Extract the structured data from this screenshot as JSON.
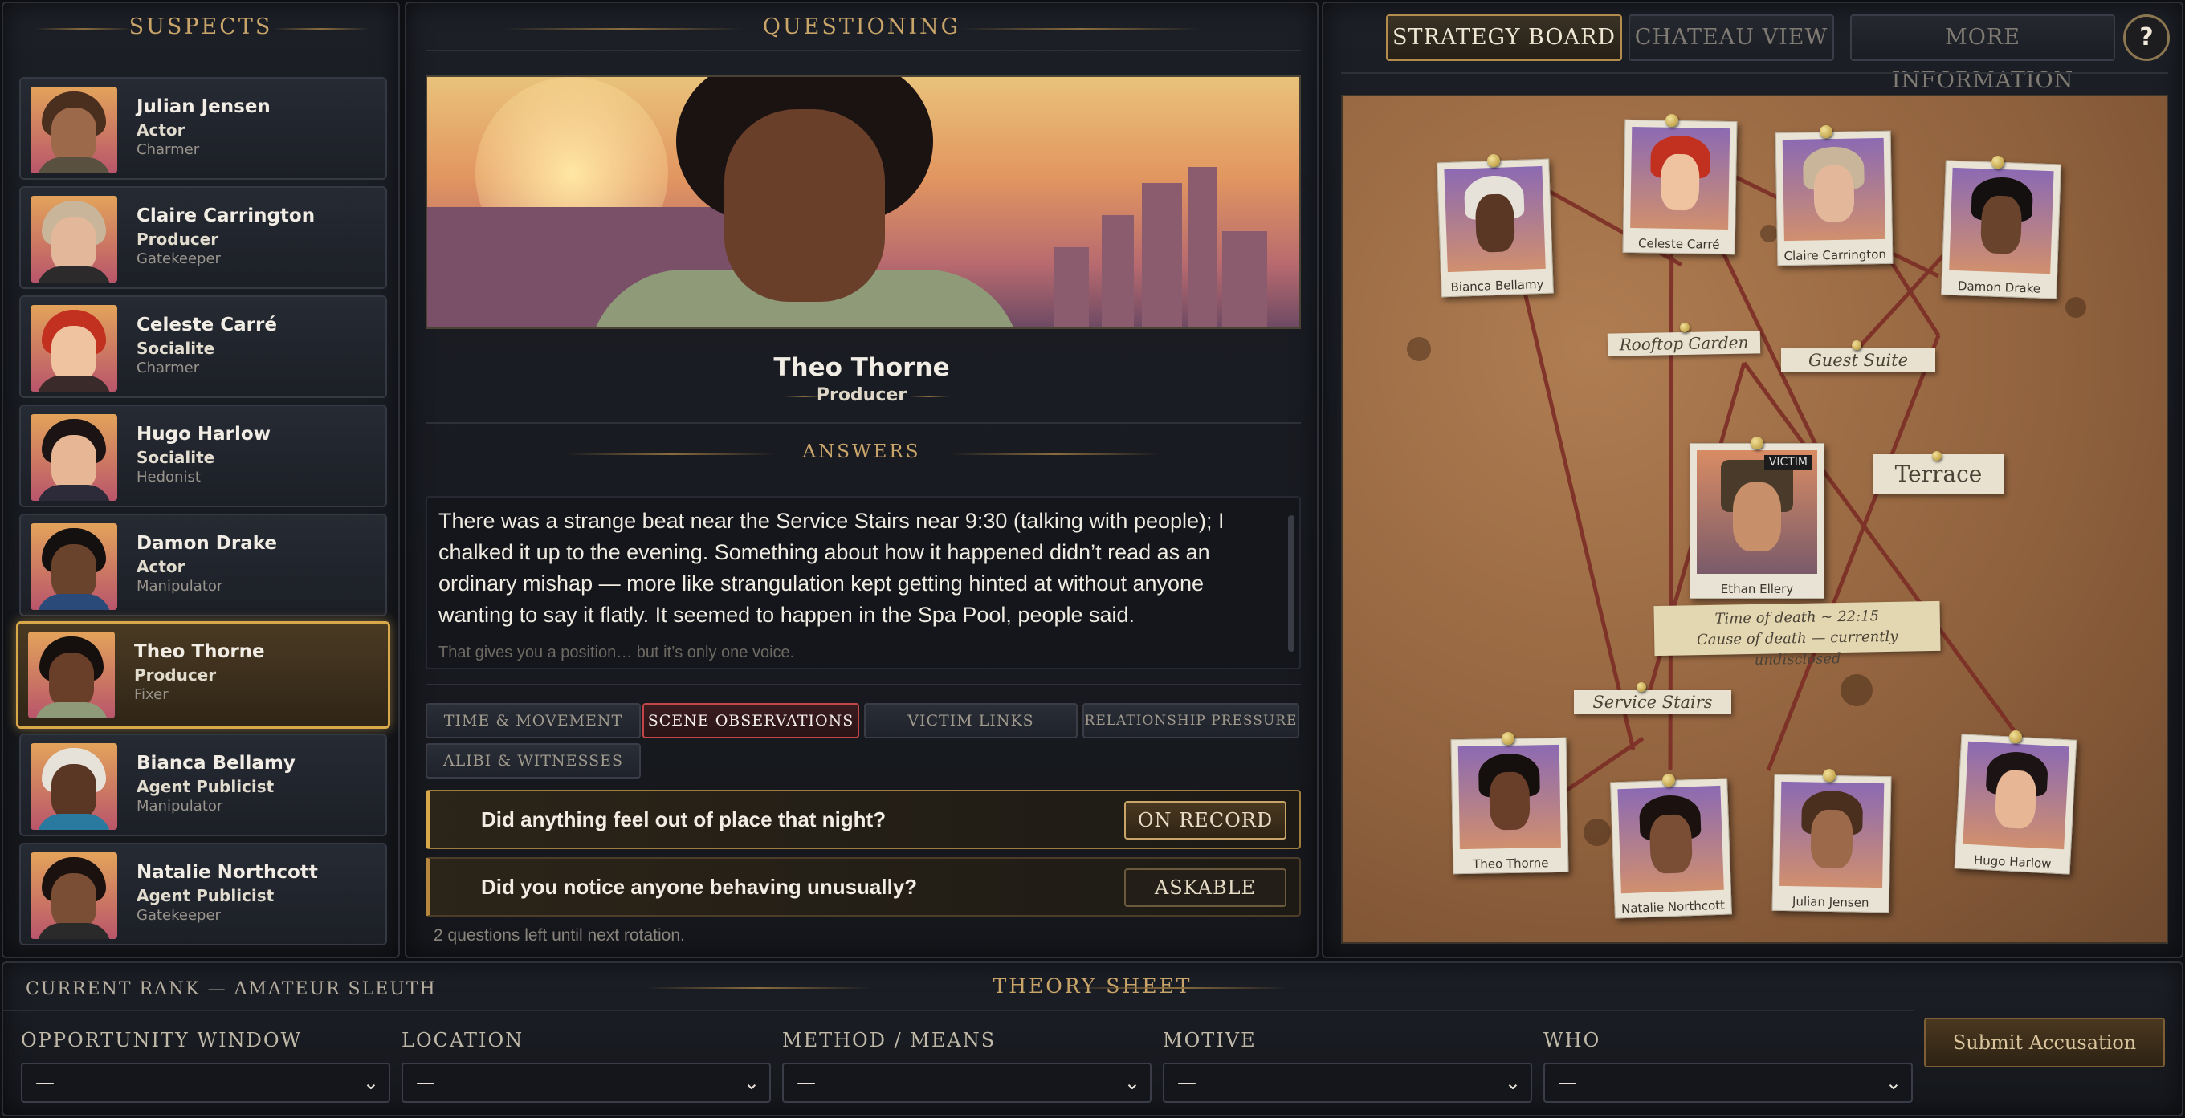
{
  "suspects_panel": {
    "title": "SUSPECTS",
    "items": [
      {
        "name": "Julian Jensen",
        "role": "Actor",
        "trait": "Charmer",
        "skin": "#9c6a4b",
        "hair": "#4a2e1e"
      },
      {
        "name": "Claire Carrington",
        "role": "Producer",
        "trait": "Gatekeeper",
        "skin": "#e2b79a",
        "hair": "#c9b69a"
      },
      {
        "name": "Celeste Carré",
        "role": "Socialite",
        "trait": "Charmer",
        "skin": "#efc3a0",
        "hair": "#c2311f"
      },
      {
        "name": "Hugo Harlow",
        "role": "Socialite",
        "trait": "Hedonist",
        "skin": "#e7b795",
        "hair": "#1c1414"
      },
      {
        "name": "Damon Drake",
        "role": "Actor",
        "trait": "Manipulator",
        "skin": "#6a432d",
        "hair": "#141010"
      },
      {
        "name": "Theo Thorne",
        "role": "Producer",
        "trait": "Fixer",
        "skin": "#6a3f2a",
        "hair": "#150f0d"
      },
      {
        "name": "Bianca Bellamy",
        "role": "Agent Publicist",
        "trait": "Manipulator",
        "skin": "#5a3624",
        "hair": "#e6e2da"
      },
      {
        "name": "Natalie Northcott",
        "role": "Agent Publicist",
        "trait": "Gatekeeper",
        "skin": "#7a4e34",
        "hair": "#1b1210"
      }
    ],
    "selected_index": 5
  },
  "questioning": {
    "title": "QUESTIONING",
    "character_name": "Theo Thorne",
    "character_role": "Producer",
    "answers_title": "ANSWERS",
    "answer_text": "There was a strange beat near the Service Stairs near 9:30 (talking with people); I chalked it up to the evening. Something about how it happened didn’t read as an ordinary mishap — more like strangulation kept getting hinted at without anyone wanting to say it flatly. It seemed to happen in the Spa Pool, people said.",
    "answer_hint": "That gives you a position… but it’s only one voice.",
    "tabs": [
      "TIME & MOVEMENT",
      "SCENE OBSERVATIONS",
      "VICTIM LINKS",
      "RELATIONSHIP PRESSURE",
      "ALIBI & WITNESSES"
    ],
    "active_tab": "SCENE OBSERVATIONS",
    "questions": [
      {
        "text": "Did anything feel out of place that night?",
        "status": "ON RECORD"
      },
      {
        "text": "Did you notice anyone behaving unusually?",
        "status": "ASKABLE"
      }
    ],
    "questions_left": "2 questions left until next rotation."
  },
  "board": {
    "buttons": [
      "STRATEGY BOARD",
      "CHATEAU VIEW",
      "MORE INFORMATION"
    ],
    "active_button": "STRATEGY BOARD",
    "help_label": "?",
    "polaroids": {
      "bianca": "Bianca Bellamy",
      "celeste": "Celeste Carré",
      "claire": "Claire Carrington",
      "damon": "Damon Drake",
      "ethan": "Ethan Ellery",
      "theo": "Theo Thorne",
      "natalie": "Natalie Northcott",
      "julian": "Julian Jensen",
      "hugo": "Hugo Harlow"
    },
    "victim_badge": "VICTIM",
    "locations": [
      "Rooftop Garden",
      "Guest Suite",
      "Terrace",
      "Service Stairs"
    ],
    "victim_note_line1": "Time of death ~ 22:15",
    "victim_note_line2": "Cause of death — currently undisclosed"
  },
  "theory_sheet": {
    "rank": "CURRENT RANK — AMATEUR SLEUTH",
    "title": "THEORY SHEET",
    "fields": [
      {
        "label": "OPPORTUNITY WINDOW",
        "value": "—"
      },
      {
        "label": "LOCATION",
        "value": "—"
      },
      {
        "label": "METHOD / MEANS",
        "value": "—"
      },
      {
        "label": "MOTIVE",
        "value": "—"
      },
      {
        "label": "WHO",
        "value": "—"
      }
    ],
    "submit_label": "Submit Accusation"
  },
  "colors": {
    "accent_gold": "#c9a56a",
    "selected_border": "#d9a84a",
    "active_tab_red": "#c0464a"
  }
}
